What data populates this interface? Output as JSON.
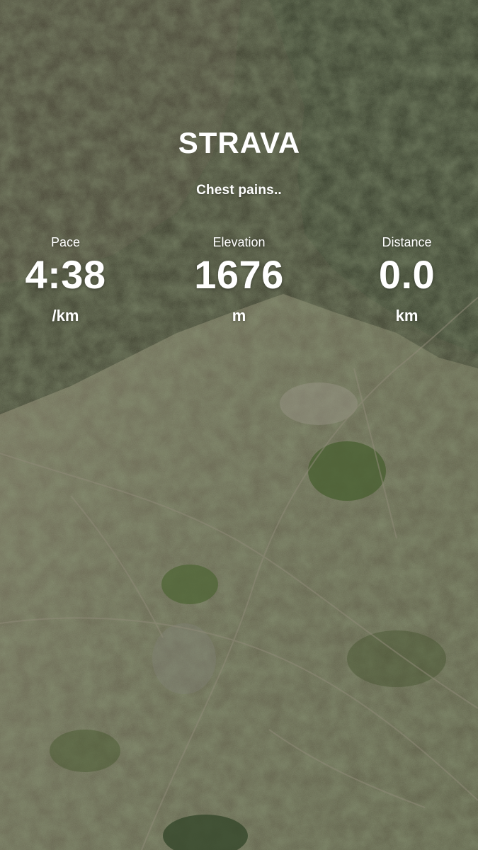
{
  "brand": {
    "name": "STRAVA",
    "logo": "strava-wordmark"
  },
  "activity": {
    "title": "Chest pains.."
  },
  "stats": {
    "pace": {
      "label": "Pace",
      "value": "4:38",
      "unit": "/km"
    },
    "elevation": {
      "label": "Elevation",
      "value": "1676",
      "unit": "m"
    },
    "distance": {
      "label": "Distance",
      "value": "0.0",
      "unit": "km"
    }
  },
  "colors": {
    "text": "#ffffff",
    "forest": "#3a3d2c",
    "urban": "#6b6b58",
    "vegetation": "#4c5a34"
  }
}
